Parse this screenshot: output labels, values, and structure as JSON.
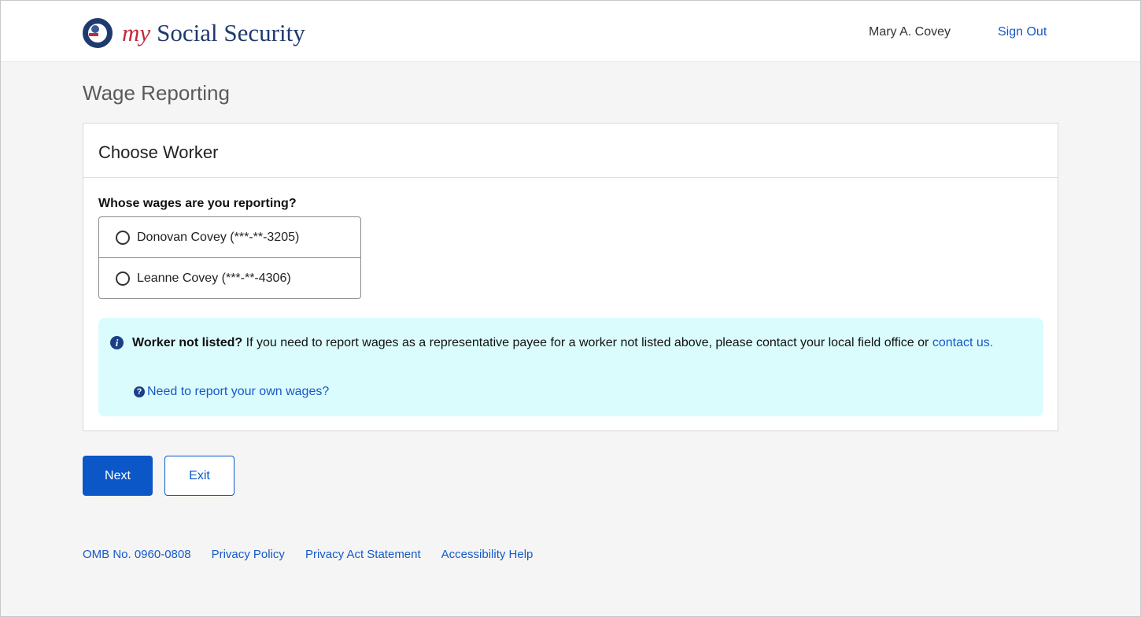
{
  "header": {
    "brand_my": "my",
    "brand_name": "Social Security",
    "user_name": "Mary A. Covey",
    "sign_out": "Sign Out",
    "seal_text": "SOCIAL SECURITY ADMINISTRATION USA"
  },
  "page": {
    "title": "Wage Reporting"
  },
  "card": {
    "title": "Choose Worker",
    "question": "Whose wages are you reporting?",
    "options": [
      {
        "label": "Donovan Covey (***-**-3205)",
        "selected": false
      },
      {
        "label": "Leanne Covey (***-**-4306)",
        "selected": false
      }
    ],
    "info": {
      "bold": "Worker not listed?",
      "text": " If you need to report wages as a representative payee for a worker not listed above, please contact your local field office or ",
      "link": "contact us.",
      "help_link": "Need to report your own wages?"
    }
  },
  "buttons": {
    "next": "Next",
    "exit": "Exit"
  },
  "footer": {
    "links": [
      "OMB No. 0960-0808",
      "Privacy Policy",
      "Privacy Act Statement",
      "Accessibility Help"
    ]
  },
  "colors": {
    "primary": "#0b57c7",
    "link": "#1659c7",
    "brand_navy": "#1f3a6e",
    "brand_red": "#c5283d",
    "info_bg": "#dbfcfd"
  },
  "icons": {
    "info": "info-circle-icon",
    "help": "question-circle-icon",
    "seal": "ssa-seal-icon"
  }
}
